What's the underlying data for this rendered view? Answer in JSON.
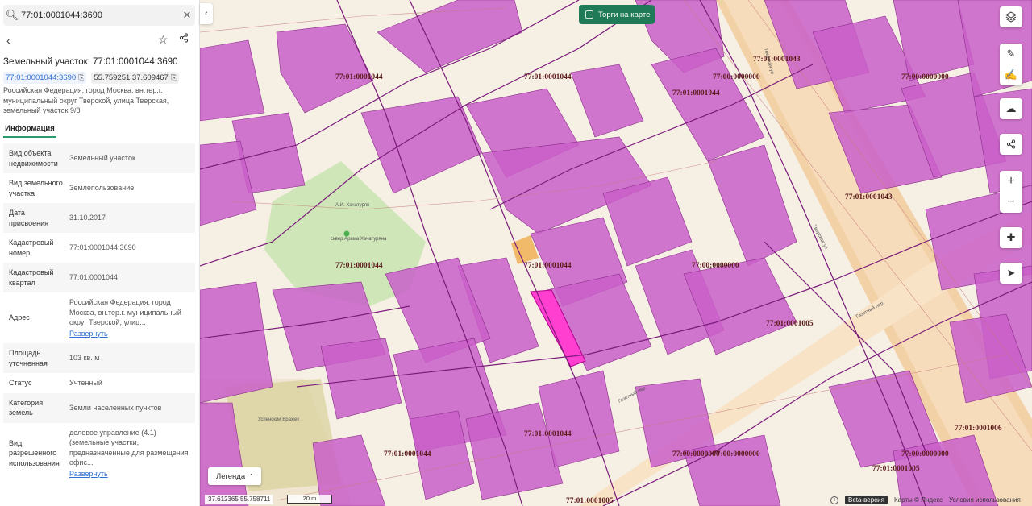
{
  "search": {
    "value": "77:01:0001044:3690",
    "placeholder": ""
  },
  "card": {
    "title": "Земельный участок: 77:01:0001044:3690",
    "cadastral_chip": "77:01:0001044:3690",
    "coords_chip": "55.759251 37.609467",
    "address": "Российская Федерация, город Москва, вн.тер.г. муниципальный округ Тверской, улица Тверская, земельный участок 9/8",
    "tab": "Информация"
  },
  "info_rows": [
    {
      "key": "Вид объекта недвижимости",
      "value": "Земельный участок"
    },
    {
      "key": "Вид земельного участка",
      "value": "Землепользование"
    },
    {
      "key": "Дата присвоения",
      "value": "31.10.2017"
    },
    {
      "key": "Кадастровый номер",
      "value": "77:01:0001044:3690"
    },
    {
      "key": "Кадастровый квартал",
      "value": "77:01:0001044"
    },
    {
      "key": "Адрес",
      "value": "Российская Федерация, город Москва, вн.тер.г. муниципальный округ Тверской, улиц...",
      "link": "Развернуть"
    },
    {
      "key": "Площадь уточненная",
      "value": "103 кв. м"
    },
    {
      "key": "Статус",
      "value": "Учтенный"
    },
    {
      "key": "Категория земель",
      "value": "Земли населенных пунктов"
    },
    {
      "key": "Вид разрешенного использования",
      "value": "деловое управление (4.1) (земельные участки, предназначенные для размещения офис...",
      "link": "Развернуть"
    }
  ],
  "map": {
    "torgi_label": "Торги на карте",
    "legend_label": "Легенда",
    "coords": "37.612365  55.758711",
    "scale": "20 m",
    "beta": "Beta-версия",
    "attribution": "Карты © Яндекс",
    "terms": "Условия использования",
    "quarter_labels": [
      {
        "text": "77:01:0001044"
      },
      {
        "text": "77:01:0001044"
      },
      {
        "text": "77:01:0001044"
      },
      {
        "text": "77:01:0001044"
      },
      {
        "text": "77:01:0001044"
      },
      {
        "text": "77:01:0001044"
      },
      {
        "text": "77:01:0001044"
      },
      {
        "text": "77:01:0001043"
      },
      {
        "text": "77:01:0001043"
      },
      {
        "text": "77:00:0000000"
      },
      {
        "text": "77:00:0000000"
      },
      {
        "text": "77:00:0000000"
      },
      {
        "text": "77:00:0000000"
      },
      {
        "text": "77:00:0000000"
      },
      {
        "text": "77:00:0000000"
      },
      {
        "text": "77:01:0001005"
      },
      {
        "text": "77:01:0001005"
      },
      {
        "text": "77:01:0001005"
      },
      {
        "text": "77:01:0001006"
      }
    ],
    "street_labels": [
      "Тверская ул.",
      "Тверская ул.",
      "Газетный пер.",
      "Газетный пер."
    ],
    "place_labels": [
      "сквер Арама Хачатуряна",
      "А.И. Хачатурян",
      "Успенский Вражек"
    ],
    "colors": {
      "building": "#c95fc9",
      "selected": "#ff3fd0",
      "parcel_line": "#7a1a7a",
      "park": "#cfe6b8",
      "road": "#f3c99a"
    }
  },
  "controls": [
    "layers-icon",
    "ruler-icon",
    "edit-icon",
    "upload-icon",
    "share-icon",
    "zoom-in-icon",
    "zoom-out-icon",
    "move-icon",
    "locate-icon"
  ]
}
